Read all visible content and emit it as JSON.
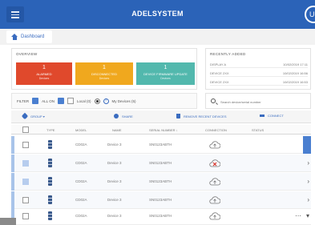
{
  "app": {
    "brand": "ADELSYSTEM",
    "user_initial": "U"
  },
  "breadcrumb": {
    "label": "Dashboard"
  },
  "overview": {
    "title": "OVERVIEW",
    "cards": [
      {
        "count": "1",
        "label": "ALARMED",
        "sub": "Devices",
        "color": "#e0492c"
      },
      {
        "count": "1",
        "label": "DISCONNECTED",
        "sub": "Devices",
        "color": "#f0a81e"
      },
      {
        "count": "1",
        "label": "DEVICE FIRMWARE UPDATE",
        "sub": "Devices",
        "color": "#52b8ad"
      }
    ]
  },
  "recent": {
    "title": "RECENTLY ADDED",
    "items": [
      {
        "name": "DISPLAY A",
        "when": "10/02/2019 17:11"
      },
      {
        "name": "DEVICE 2XX",
        "when": "10/02/2019 16:56"
      },
      {
        "name": "DEVICE 2XX",
        "when": "10/02/2019 16:53"
      }
    ]
  },
  "filter": {
    "label": "FILTER",
    "all_label": "ALL ON",
    "local_label": "Local (0)",
    "my_devices_label": "My Devices (5)"
  },
  "search": {
    "placeholder": "Search device/serial number"
  },
  "toolbar": {
    "group_label": "GROUP ▾",
    "share_label": "SHARE",
    "remove_label": "REMOVE RECENT DEVICES",
    "connect_label": "CONNECT"
  },
  "table": {
    "headers": [
      "TYPE",
      "MODEL",
      "NAME",
      "SERIAL NUMBER ↓",
      "CONNECTION",
      "STATUS"
    ],
    "rows": [
      {
        "model": "CD02A",
        "name": "Device 3",
        "serial": "SN0123ABTH",
        "connected": true
      },
      {
        "model": "CD02A",
        "name": "Device 3",
        "serial": "SN0123ABTH",
        "connected": false
      },
      {
        "model": "CD02A",
        "name": "Device 3",
        "serial": "SN0123ABTH",
        "connected": true
      },
      {
        "model": "CD02A",
        "name": "Device 3",
        "serial": "SN0123ABTH",
        "connected": true
      },
      {
        "model": "CD02A",
        "name": "Device 3",
        "serial": "SN0123ABTH",
        "connected": true
      }
    ]
  },
  "colors": {
    "primary": "#2b63b8",
    "accent": "#4a7fd0",
    "error": "#d9342b"
  }
}
